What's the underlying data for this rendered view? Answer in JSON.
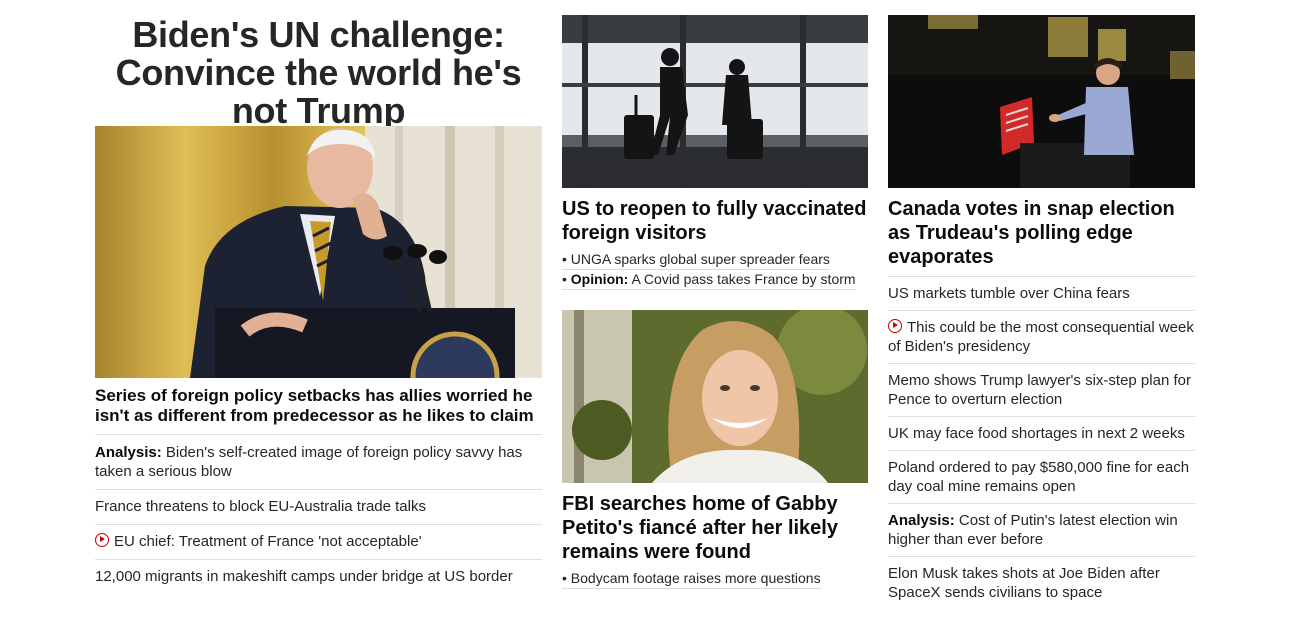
{
  "main_story": {
    "headline": "Biden's UN challenge: Convince the world he's not Trump",
    "image_alt": "Joe Biden at a podium with the presidential seal",
    "lead": "Series of foreign policy setbacks has allies worried he isn't as different from predecessor as he likes to claim",
    "items": [
      {
        "prefix": "Analysis:",
        "text": "Biden's self-created image of foreign policy savvy has taken a serious blow"
      },
      {
        "prefix": "",
        "text": "France threatens to block EU-Australia trade talks"
      },
      {
        "prefix": "",
        "text": "EU chief: Treatment of France 'not acceptable'",
        "video": true
      },
      {
        "prefix": "",
        "text": "12,000 migrants in makeshift camps under bridge at US border"
      }
    ]
  },
  "story_travel": {
    "image_alt": "Silhouettes of travelers with luggage in airport",
    "headline": "US to reopen to fully vaccinated foreign visitors",
    "subs": [
      {
        "prefix": "",
        "text": "UNGA sparks global super spreader fears"
      },
      {
        "prefix": "Opinion:",
        "text": "A Covid pass takes France by storm"
      }
    ],
    "bullet": "•"
  },
  "story_petito": {
    "image_alt": "Smiling young woman with long blonde hair",
    "headline": "FBI searches home of Gabby Petito's fiancé after her likely remains were found",
    "subs": [
      {
        "prefix": "",
        "text": "Bodycam footage raises more questions"
      }
    ]
  },
  "story_canada": {
    "image_alt": "Justin Trudeau speaking at a podium",
    "headline": "Canada votes in snap election as Trudeau's polling edge evaporates",
    "items": [
      {
        "prefix": "",
        "text": "US markets tumble over China fears"
      },
      {
        "prefix": "",
        "text": "This could be the most consequential week of Biden's presidency",
        "video": true
      },
      {
        "prefix": "",
        "text": "Memo shows Trump lawyer's six-step plan for Pence to overturn election"
      },
      {
        "prefix": "",
        "text": "UK may face food shortages in next 2 weeks"
      },
      {
        "prefix": "",
        "text": "Poland ordered to pay $580,000 fine for each day coal mine remains open"
      },
      {
        "prefix": "Analysis:",
        "text": "Cost of Putin's latest election win higher than ever before"
      },
      {
        "prefix": "",
        "text": "Elon Musk takes shots at Joe Biden after SpaceX sends civilians to space"
      }
    ]
  },
  "colors": {
    "video_icon": "#cc0000",
    "divider": "#e0e0e0"
  }
}
